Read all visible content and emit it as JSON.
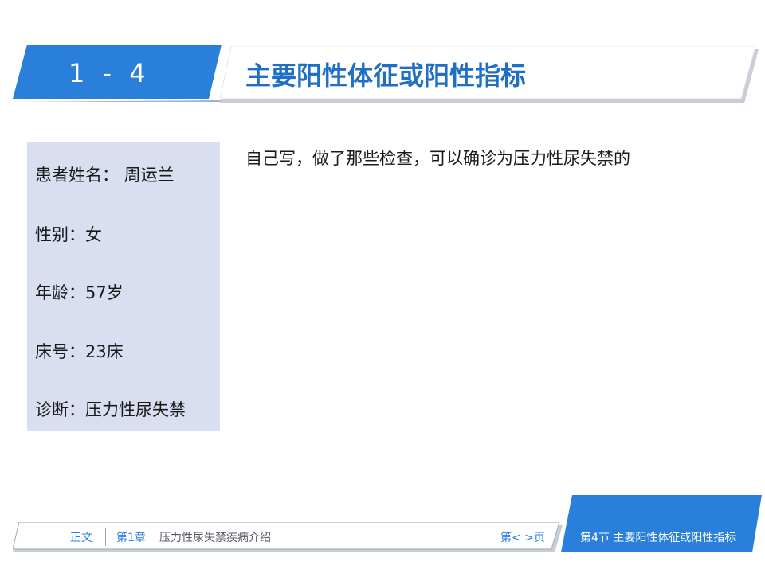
{
  "header": {
    "section_number": "1 - 4",
    "title": "主要阳性体征或阳性指标"
  },
  "patient_info": {
    "name_line": "患者姓名：  周运兰",
    "gender_line": "性别：女",
    "age_line": "年龄：57岁",
    "bed_line": " 床号：23床",
    "diagnosis_line": "诊断：压力性尿失禁"
  },
  "body": {
    "note": "自己写，做了那些检查，可以确诊为压力性尿失禁的"
  },
  "footer": {
    "main_label": "正文",
    "chapter_label": "第1章",
    "chapter_title": "压力性尿失禁疾病介绍",
    "page_label": "第<   >页",
    "section_label": "第4节   主要阳性体征或阳性指标"
  },
  "colors": {
    "accent_blue": "#2a7fdb",
    "title_blue": "#1f6fc5",
    "info_bg": "#d9dff0"
  }
}
